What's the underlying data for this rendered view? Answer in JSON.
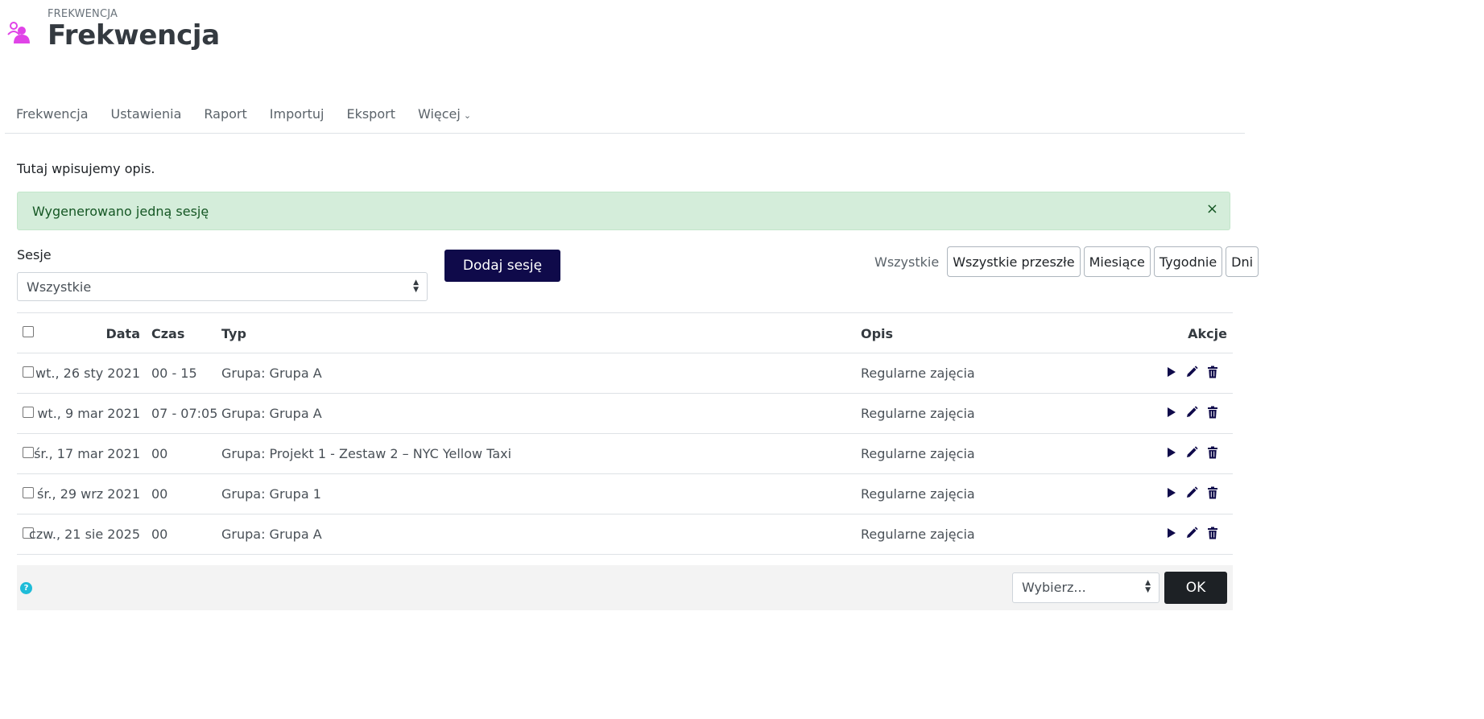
{
  "header": {
    "pre_title": "FREKWENCJA",
    "title": "Frekwencja",
    "icon": "attendance-people-icon",
    "icon_color": "#e044e7"
  },
  "tabs": [
    {
      "label": "Frekwencja"
    },
    {
      "label": "Ustawienia"
    },
    {
      "label": "Raport"
    },
    {
      "label": "Importuj"
    },
    {
      "label": "Eksport"
    },
    {
      "label": "Więcej"
    }
  ],
  "description": "Tutaj wpisujemy opis.",
  "alert": {
    "text": "Wygenerowano jedną sesję",
    "close": "×",
    "bg_color": "#d4edda",
    "text_color": "#155724"
  },
  "filter": {
    "label": "Sesje",
    "selected": "Wszystkie"
  },
  "add_session_label": "Dodaj sesję",
  "views": {
    "current": "Wszystkie",
    "buttons": [
      "Wszystkie przeszłe",
      "Miesiące",
      "Tygodnie",
      "Dni"
    ]
  },
  "table": {
    "headers": {
      "date": "Data",
      "time": "Czas",
      "type": "Typ",
      "description": "Opis",
      "actions": "Akcje"
    },
    "rows": [
      {
        "date": "wt., 26 sty 2021",
        "time": "00 - 15",
        "type": "Grupa: Grupa A",
        "description": "Regularne zajęcia"
      },
      {
        "date": "wt., 9 mar 2021",
        "time": "07 - 07:05",
        "type": "Grupa: Grupa A",
        "description": "Regularne zajęcia"
      },
      {
        "date": "śr., 17 mar 2021",
        "time": "00",
        "type": "Grupa: Projekt 1 - Zestaw 2 – NYC Yellow Taxi",
        "description": "Regularne zajęcia"
      },
      {
        "date": "śr., 29 wrz 2021",
        "time": "00",
        "type": "Grupa: Grupa 1",
        "description": "Regularne zajęcia"
      },
      {
        "date": "czw., 21 sie 2025",
        "time": "00",
        "type": "Grupa: Grupa A",
        "description": "Regularne zajęcia"
      }
    ],
    "row_action_icons": [
      "play-icon",
      "pencil-icon",
      "trash-icon"
    ]
  },
  "footer": {
    "help": "?",
    "bulk_select": "Wybierz...",
    "ok_label": "OK"
  },
  "colors": {
    "primary_button": "#0f0a4a",
    "ok_button": "#1d2125",
    "help_icon": "#1ebcd8"
  }
}
